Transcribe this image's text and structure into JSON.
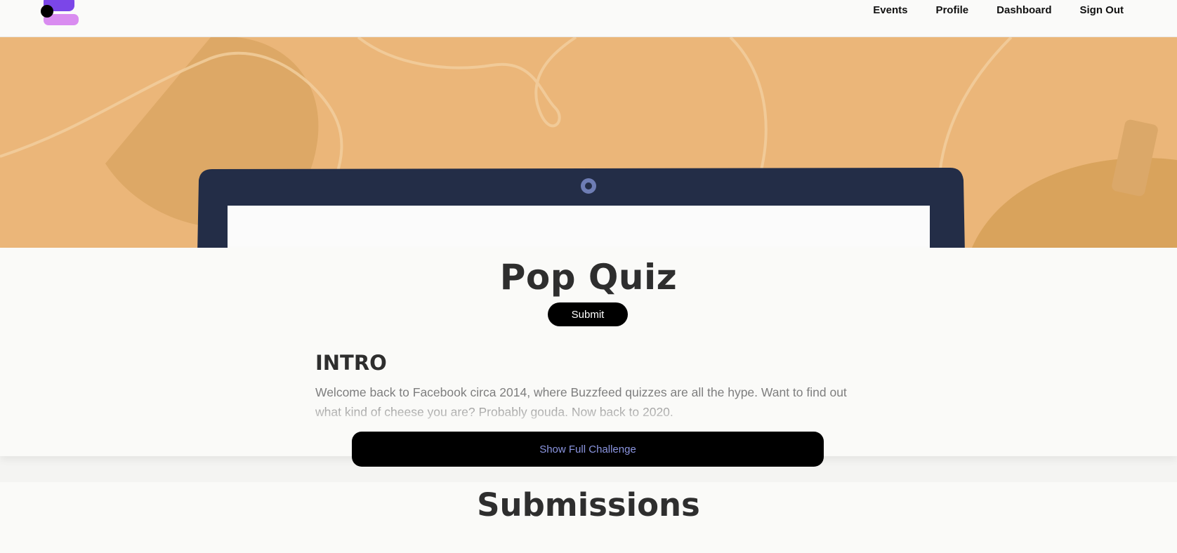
{
  "nav": {
    "items": [
      {
        "label": "Events"
      },
      {
        "label": "Profile"
      },
      {
        "label": "Dashboard"
      },
      {
        "label": "Sign Out"
      }
    ]
  },
  "challenge": {
    "title": "Pop Quiz",
    "submit_label": "Submit",
    "section_heading": "INTRO",
    "intro_text": "Welcome back to Facebook circa 2014, where Buzzfeed quizzes are all the hype. Want to find out what kind of cheese you are? Probably gouda. Now back to 2020.",
    "show_full_label": "Show Full Challenge"
  },
  "submissions": {
    "title": "Submissions"
  },
  "colors": {
    "hero_bg": "#ebb679",
    "laptop": "#232d47",
    "logo_purple": "#7b46e8",
    "logo_pink": "#d98cf0",
    "accent_text": "#8b95e0"
  }
}
